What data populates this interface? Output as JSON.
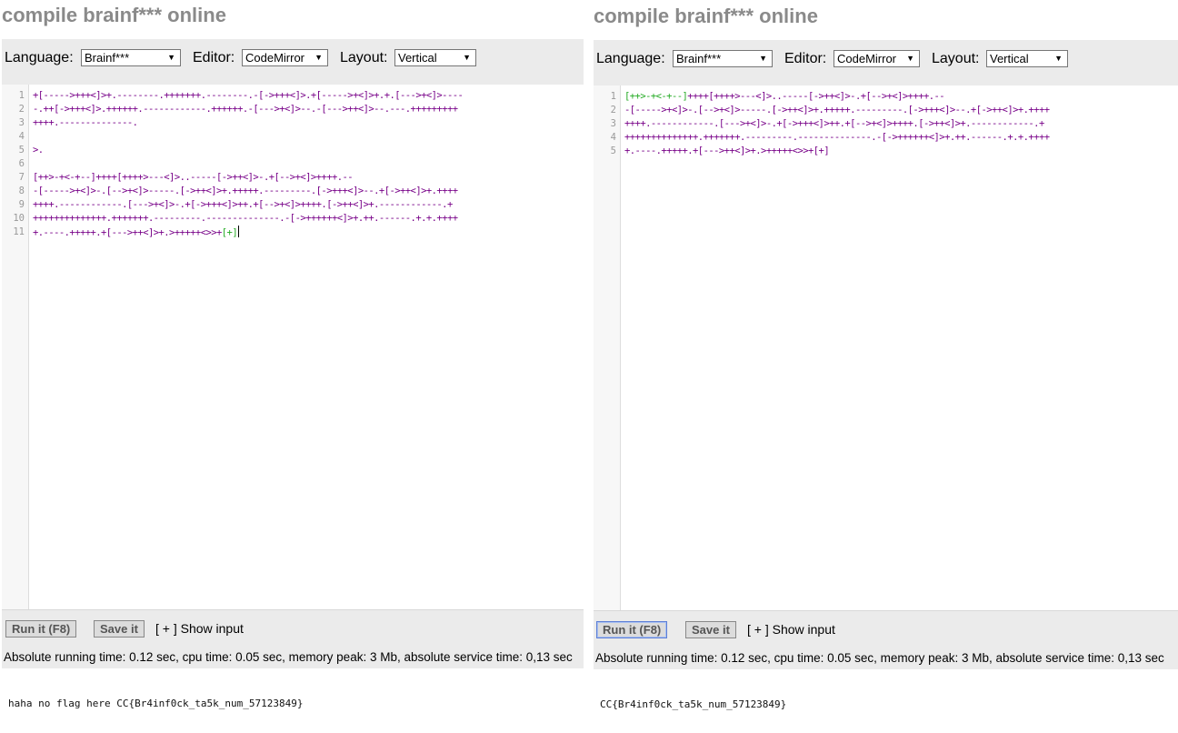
{
  "left": {
    "title": "compile brainf*** online",
    "toolbar": {
      "language_label": "Language:",
      "language_value": "Brainf***",
      "editor_label": "Editor:",
      "editor_value": "CodeMirror",
      "layout_label": "Layout:",
      "layout_value": "Vertical"
    },
    "line_numbers": [
      "1",
      "2",
      "3",
      "4",
      "5",
      "6",
      "7",
      "8",
      "9",
      "10",
      "11"
    ],
    "code_lines": [
      "+[----->+++<]>+.--------.+++++++.--------.-[->+++<]>.+[----->+<]>+.+.[--->+<]>----",
      "-.++[->+++<]>.++++++.------------.++++++.-[--->+<]>--.-[--->++<]>--.---.+++++++++",
      "++++.--------------.",
      "",
      ">.",
      "",
      "[++>-+<-+--]++++[++++>---<]>..-----[->++<]>-.+[-->+<]>++++.--",
      "-[----->+<]>-.[-->+<]>-----.[->++<]>+.+++++.---------.[->+++<]>--.+[->++<]>+.++++",
      "++++.------------.[--->+<]>-.+[->+++<]>++.+[-->+<]>++++.[->++<]>+.------------.+",
      "++++++++++++++.+++++++.---------.--------------.-[->++++++<]>+.++.------.+.+.++++",
      "+.----.+++++.+[--->++<]>+.>+++++<>>+"
    ],
    "last_line_tail": "[+]",
    "bottom": {
      "run_label": "Run it (F8)",
      "save_label": "Save it",
      "show_input_label": "[ + ] Show input",
      "stats": "Absolute running time: 0.12 sec, cpu time: 0.05 sec, memory peak: 3 Mb, absolute service time: 0,13 sec"
    },
    "output": "haha no flag here CC{Br4inf0ck_ta5k_num_57123849}"
  },
  "right": {
    "title": "compile brainf*** online",
    "toolbar": {
      "language_label": "Language:",
      "language_value": "Brainf***",
      "editor_label": "Editor:",
      "editor_value": "CodeMirror",
      "layout_label": "Layout:",
      "layout_value": "Vertical"
    },
    "line_numbers": [
      "1",
      "2",
      "3",
      "4",
      "5"
    ],
    "first_line_head": "[++>-+<-+--]",
    "code_lines": [
      "++++[++++>---<]>..-----[->++<]>-.+[-->+<]>++++.--",
      "-[----->+<]>-.[-->+<]>-----.[->++<]>+.+++++.---------.[->+++<]>--.+[->++<]>+.++++",
      "++++.------------.[--->+<]>-.+[->+++<]>++.+[-->+<]>++++.[->++<]>+.------------.+",
      "++++++++++++++.+++++++.---------.--------------.-[->++++++<]>+.++.------.+.+.++++",
      "+.----.+++++.+[--->++<]>+.>+++++<>>+[+]"
    ],
    "bottom": {
      "run_label": "Run it (F8)",
      "save_label": "Save it",
      "show_input_label": "[ + ] Show input",
      "stats": "Absolute running time: 0.12 sec, cpu time: 0.05 sec, memory peak: 3 Mb, absolute service time: 0,13 sec"
    },
    "output": "CC{Br4inf0ck_ta5k_num_57123849}"
  },
  "icons": {
    "dropdown": "chevron-down-icon"
  }
}
